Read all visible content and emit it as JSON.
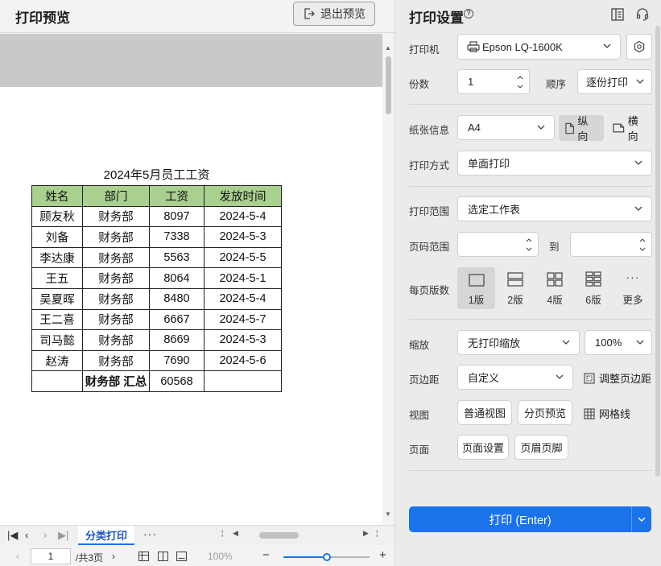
{
  "preview": {
    "title": "打印预览",
    "exit_label": "退出预览",
    "sheet_title": "2024年5月员工工资",
    "table": {
      "headers": [
        "姓名",
        "部门",
        "工资",
        "发放时间"
      ],
      "rows": [
        [
          "顾友秋",
          "财务部",
          "8097",
          "2024-5-4"
        ],
        [
          "刘备",
          "财务部",
          "7338",
          "2024-5-3"
        ],
        [
          "李达康",
          "财务部",
          "5563",
          "2024-5-5"
        ],
        [
          "王五",
          "财务部",
          "8064",
          "2024-5-1"
        ],
        [
          "吴夏晖",
          "财务部",
          "8480",
          "2024-5-4"
        ],
        [
          "王二喜",
          "财务部",
          "6667",
          "2024-5-7"
        ],
        [
          "司马懿",
          "财务部",
          "8669",
          "2024-5-3"
        ],
        [
          "赵涛",
          "财务部",
          "7690",
          "2024-5-6"
        ]
      ],
      "summary": [
        "",
        "财务部 汇总",
        "60568",
        ""
      ]
    },
    "sheet_tab": "分类打印",
    "sheet_more": "···",
    "page_input": "1",
    "page_total": "/共3页",
    "zoom": "100%",
    "zoom_level": 0.5
  },
  "settings": {
    "title": "打印设置",
    "printer_label": "打印机",
    "printer_value": "Epson LQ-1600K",
    "copies_label": "份数",
    "copies_value": "1",
    "order_label": "顺序",
    "order_value": "逐份打印",
    "paper_label": "纸张信息",
    "paper_value": "A4",
    "portrait": "纵向",
    "landscape": "横向",
    "mode_label": "打印方式",
    "mode_value": "单面打印",
    "range_label": "打印范围",
    "range_value": "选定工作表",
    "pages_label": "页码范围",
    "pages_to": "到",
    "per_page_label": "每页版数",
    "per_page_options": [
      "1版",
      "2版",
      "4版",
      "6版",
      "更多"
    ],
    "scale_label": "缩放",
    "scale_value": "无打印缩放",
    "scale_percent": "100%",
    "margin_label": "页边距",
    "margin_value": "自定义",
    "adjust_margin": "调整页边距",
    "view_label": "视图",
    "normal_view": "普通视图",
    "page_break_view": "分页预览",
    "gridlines": "网格线",
    "page_label": "页面",
    "page_setup": "页面设置",
    "header_footer": "页眉页脚",
    "print_button": "打印 (Enter)"
  },
  "colors": {
    "accent": "#1a73e8",
    "table_header": "#a9d08e"
  }
}
